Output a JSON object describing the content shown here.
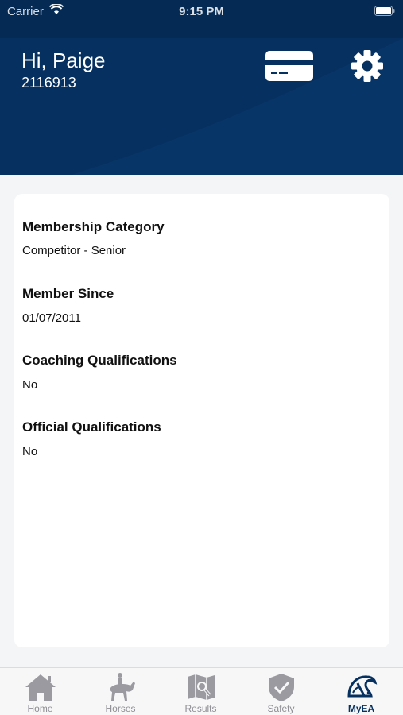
{
  "status_bar": {
    "carrier": "Carrier",
    "time": "9:15 PM"
  },
  "header": {
    "greeting": "Hi, Paige",
    "member_id": "2116913",
    "card_icon": "membership-card-icon",
    "settings_icon": "gear-icon"
  },
  "details": [
    {
      "label": "Membership Category",
      "value": "Competitor - Senior"
    },
    {
      "label": "Member Since",
      "value": "01/07/2011"
    },
    {
      "label": "Coaching Qualifications",
      "value": "No"
    },
    {
      "label": "Official Qualifications",
      "value": "No"
    }
  ],
  "tabs": [
    {
      "label": "Home",
      "icon": "home-icon",
      "active": false
    },
    {
      "label": "Horses",
      "icon": "dressage-rider-icon",
      "active": false
    },
    {
      "label": "Results",
      "icon": "results-map-icon",
      "active": false
    },
    {
      "label": "Safety",
      "icon": "shield-check-icon",
      "active": false
    },
    {
      "label": "MyEA",
      "icon": "myea-logo-icon",
      "active": true
    }
  ],
  "colors": {
    "header_bg": "#06305f",
    "active_tab": "#06305f",
    "inactive_tab": "#8e8e93"
  }
}
